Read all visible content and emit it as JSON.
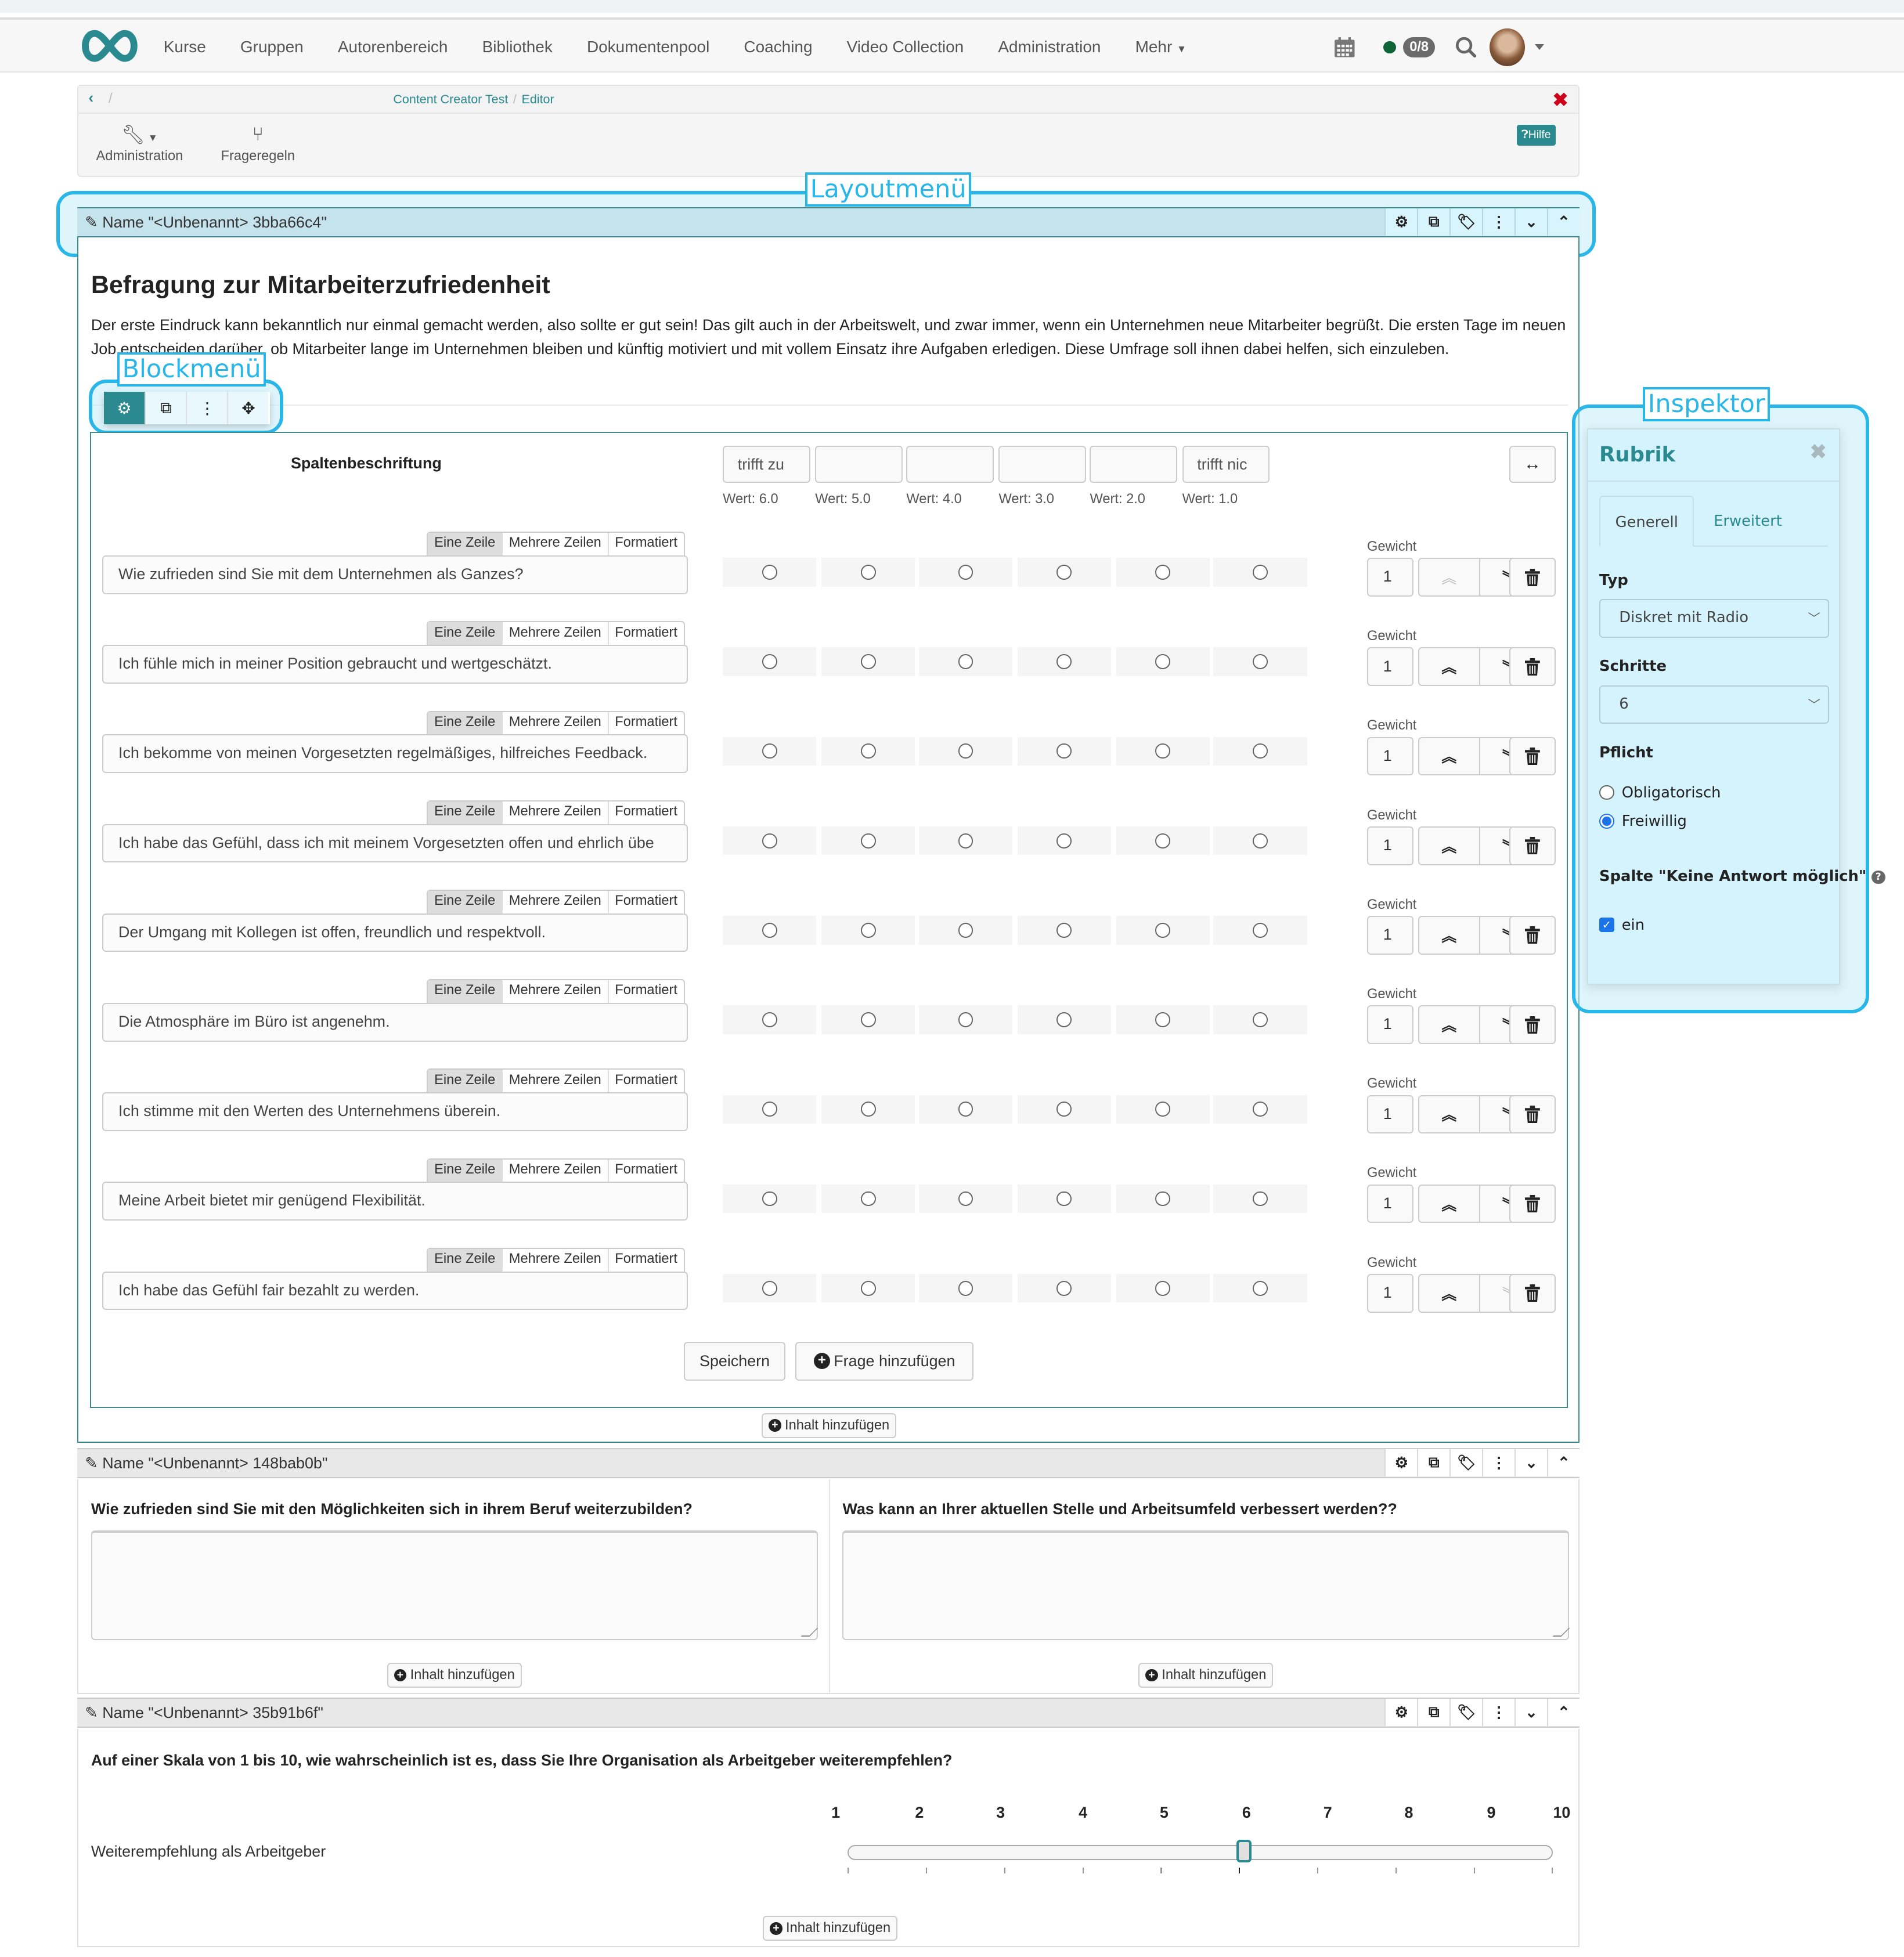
{
  "nav": {
    "items": [
      "Kurse",
      "Gruppen",
      "Autorenbereich",
      "Bibliothek",
      "Dokumentenpool",
      "Coaching",
      "Video Collection",
      "Administration",
      "Mehr"
    ],
    "status_badge": "0/8",
    "brand_color": "#2a8a90",
    "online_status_color": "#0e6537"
  },
  "toolbar": {
    "breadcrumb": [
      "Content Creator Test",
      "Editor"
    ],
    "tools": [
      "Administration",
      "Frageregeln"
    ],
    "help_label": "Hilfe"
  },
  "annotations": {
    "layout_menu": "Layoutmenü",
    "block_menu": "Blockmenü",
    "inspector": "Inspektor",
    "color": "#29b6e8"
  },
  "block1": {
    "name": "Name \"<Unbenannt> 3bba66c4\"",
    "title": "Befragung zur Mitarbeiterzufriedenheit",
    "intro": "Der erste Eindruck kann bekanntlich nur einmal gemacht werden, also sollte er gut sein! Das gilt auch in der Arbeitswelt, und zwar immer, wenn ein Unternehmen neue Mitarbeiter begrüßt. Die ersten Tage im neuen Job entscheiden darüber, ob Mitarbeiter lange im Unternehmen bleiben und künftig motiviert und mit vollem Einsatz ihre Aufgaben erledigen. Diese Umfrage soll ihnen dabei helfen, sich einzuleben.",
    "rubric": {
      "column_header": "Spaltenbeschriftung",
      "columns": [
        {
          "label": "trifft zu",
          "value": "Wert: 6.0"
        },
        {
          "label": "",
          "value": "Wert: 5.0"
        },
        {
          "label": "",
          "value": "Wert: 4.0"
        },
        {
          "label": "",
          "value": "Wert: 3.0"
        },
        {
          "label": "",
          "value": "Wert: 2.0"
        },
        {
          "label": "trifft nic",
          "value": "Wert: 1.0"
        }
      ],
      "input_modes": [
        "Eine Zeile",
        "Mehrere Zeilen",
        "Formatiert"
      ],
      "weight_label": "Gewicht",
      "questions": [
        {
          "text": "Wie zufrieden sind Sie mit dem Unternehmen als Ganzes?",
          "weight": "1",
          "up_disabled": true,
          "down_disabled": false
        },
        {
          "text": "Ich fühle mich in meiner Position gebraucht und wertgeschätzt.",
          "weight": "1",
          "up_disabled": false,
          "down_disabled": false
        },
        {
          "text": "Ich bekomme von meinen Vorgesetzten regelmäßiges, hilfreiches Feedback.",
          "weight": "1",
          "up_disabled": false,
          "down_disabled": false
        },
        {
          "text": "Ich habe das Gefühl, dass ich mit meinem Vorgesetzten offen und ehrlich übe",
          "weight": "1",
          "up_disabled": false,
          "down_disabled": false
        },
        {
          "text": "Der Umgang mit Kollegen ist offen, freundlich und respektvoll.",
          "weight": "1",
          "up_disabled": false,
          "down_disabled": false
        },
        {
          "text": "Die Atmosphäre im Büro ist angenehm.",
          "weight": "1",
          "up_disabled": false,
          "down_disabled": false
        },
        {
          "text": "Ich stimme mit den Werten des Unternehmens überein.",
          "weight": "1",
          "up_disabled": false,
          "down_disabled": false
        },
        {
          "text": "Meine Arbeit bietet mir genügend Flexibilität.",
          "weight": "1",
          "up_disabled": false,
          "down_disabled": false
        },
        {
          "text": "Ich habe das Gefühl fair bezahlt zu werden.",
          "weight": "1",
          "up_disabled": false,
          "down_disabled": true
        }
      ],
      "save_label": "Speichern",
      "add_question_label": "Frage hinzufügen"
    },
    "add_content_label": "Inhalt hinzufügen"
  },
  "block2": {
    "name": "Name \"<Unbenannt> 148bab0b\"",
    "questions": [
      "Wie zufrieden sind Sie mit den Möglichkeiten sich in ihrem Beruf weiterzubilden?",
      "Was kann an Ihrer aktuellen Stelle und Arbeitsumfeld verbessert werden??"
    ],
    "add_content_label": "Inhalt hinzufügen"
  },
  "block3": {
    "name": "Name \"<Unbenannt> 35b91b6f\"",
    "question": "Auf einer Skala von 1 bis 10, wie wahrscheinlich ist es, dass Sie Ihre Organisation als Arbeitgeber weiterempfehlen?",
    "scale": [
      "1",
      "2",
      "3",
      "4",
      "5",
      "6",
      "7",
      "8",
      "9",
      "10"
    ],
    "slider_label": "Weiterempfehlung als Arbeitgeber",
    "slider_value": 6,
    "slider_min": 1,
    "slider_max": 10,
    "add_content_label": "Inhalt hinzufügen"
  },
  "inspector": {
    "title": "Rubrik",
    "tabs": [
      "Generell",
      "Erweitert"
    ],
    "type_label": "Typ",
    "type_value": "Diskret mit Radio",
    "steps_label": "Schritte",
    "steps_value": "6",
    "required_label": "Pflicht",
    "required_options": [
      "Obligatorisch",
      "Freiwillig"
    ],
    "required_selected": "Freiwillig",
    "no_answer_label": "Spalte \"Keine Antwort möglich\"",
    "no_answer_option": "ein",
    "no_answer_checked": true
  }
}
